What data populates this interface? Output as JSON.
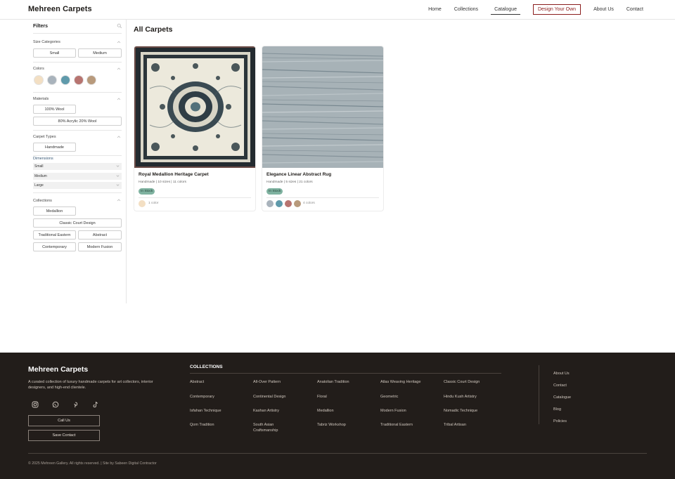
{
  "header": {
    "brand": "Mehreen Carpets",
    "nav": [
      "Home",
      "Collections",
      "Catalogue",
      "Design Your Own",
      "About Us",
      "Contact"
    ]
  },
  "sidebar": {
    "title": "Filters",
    "size_categories": {
      "label": "Size Categories",
      "options": [
        "Small",
        "Medium"
      ]
    },
    "colors": {
      "label": "Colors",
      "swatches": [
        "#f3dfc3",
        "#a9b3bc",
        "#5f9aab",
        "#b77470",
        "#b89a7c"
      ]
    },
    "materials": {
      "label": "Materials",
      "options": [
        "100% Wool",
        "80% Acrylic 20% Wool"
      ]
    },
    "carpet_types": {
      "label": "Carpet Types",
      "options": [
        "Handmade"
      ]
    },
    "dimensions": {
      "label": "Dimensions",
      "options": [
        "Small",
        "Medium",
        "Large"
      ]
    },
    "collections": {
      "label": "Collections",
      "options": [
        "Medallion",
        "Classic Court Design",
        "Traditional Eastern",
        "Abstract",
        "Contemporary",
        "Modern Fusion"
      ]
    }
  },
  "main": {
    "title": "All Carpets",
    "products": [
      {
        "name": "Royal Medallion Heritage Carpet",
        "meta": "Handmade | 10 sizes | 11 colors",
        "badge": "In Stock",
        "swatches": [
          "#f3dfc3"
        ],
        "color_count": "1 color"
      },
      {
        "name": "Elegance Linear Abstract Rug",
        "meta": "Handmade | 5 sizes | 21 colors",
        "badge": "In Stock",
        "swatches": [
          "#a9b3bc",
          "#5f9aab",
          "#b77470",
          "#b89a7c"
        ],
        "color_count": "4 colors"
      }
    ]
  },
  "footer": {
    "brand": "Mehreen Carpets",
    "description": "A curated collection of luxury handmade carpets for art collectors, interior designers, and high-end clientele.",
    "social_icons": [
      "instagram-icon",
      "whatsapp-icon",
      "pinterest-icon",
      "tiktok-icon"
    ],
    "call_button": "Call Us",
    "save_button": "Save Contact",
    "collections_title": "COLLECTIONS",
    "collections": [
      "Abstract",
      "All-Over Pattern",
      "Anatolian Tradition",
      "Atlas Weaving Heritage",
      "Classic Court Design",
      "Contemporary",
      "Continental Design",
      "Floral",
      "Geometric",
      "Hindu Kush Artistry",
      "Isfahan Technique",
      "Kashan Artistry",
      "Medallion",
      "Modern Fusion",
      "Nomadic Technique",
      "Qom Tradition",
      "South Asian Craftsmanship",
      "Tabriz Workshop",
      "Traditional Eastern",
      "Tribal Artisan"
    ],
    "links": [
      "About Us",
      "Contact",
      "Catalogue",
      "Blog",
      "Policies"
    ],
    "copyright": "© 2025 Mehreen Gallery. All rights reserved. | Site by Sabeen Digital Contractor"
  }
}
